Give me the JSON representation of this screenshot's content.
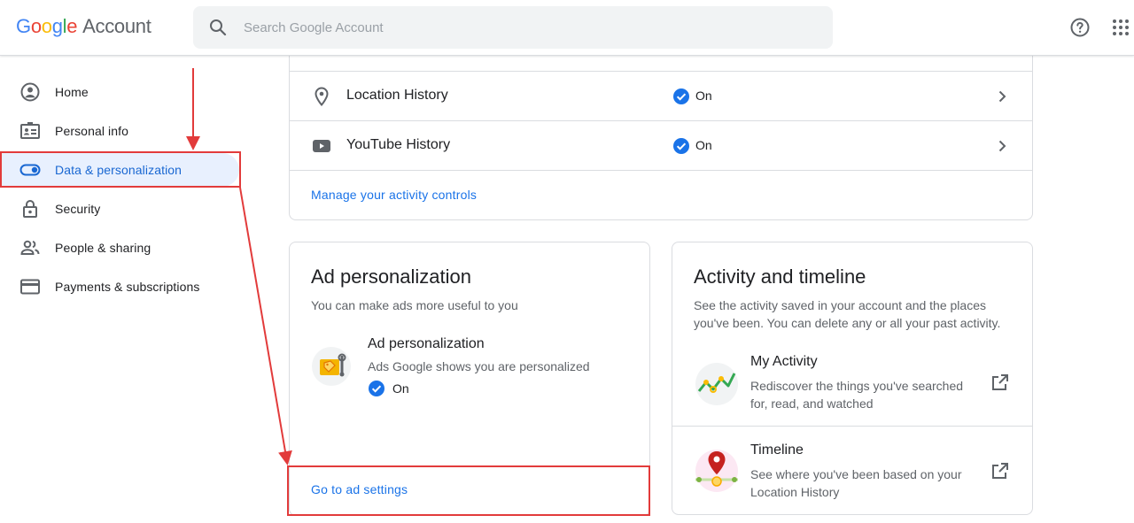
{
  "header": {
    "logo_google": [
      "G",
      "o",
      "o",
      "g",
      "l",
      "e"
    ],
    "logo_account": "Account",
    "search_placeholder": "Search Google Account",
    "icons": [
      "search-icon",
      "help-icon",
      "apps-icon"
    ]
  },
  "sidebar": {
    "items": [
      {
        "label": "Home",
        "icon": "home-icon",
        "active": false
      },
      {
        "label": "Personal info",
        "icon": "id-card-icon",
        "active": false
      },
      {
        "label": "Data & personalization",
        "icon": "toggle-icon",
        "active": true
      },
      {
        "label": "Security",
        "icon": "lock-icon",
        "active": false
      },
      {
        "label": "People & sharing",
        "icon": "people-icon",
        "active": false
      },
      {
        "label": "Payments & subscriptions",
        "icon": "credit-card-icon",
        "active": false
      }
    ]
  },
  "activity_controls": {
    "rows": [
      {
        "label": "Location History",
        "status": "On",
        "icon": "location-pin-icon"
      },
      {
        "label": "YouTube History",
        "status": "On",
        "icon": "youtube-icon"
      }
    ],
    "manage_link": "Manage your activity controls"
  },
  "ad_personalization": {
    "title": "Ad personalization",
    "subtitle": "You can make ads more useful to you",
    "item_title": "Ad personalization",
    "item_desc": "Ads Google shows you are personalized",
    "item_status": "On",
    "link": "Go to ad settings"
  },
  "activity_timeline": {
    "title": "Activity and timeline",
    "subtitle_line1": "See the activity saved in your account and the places",
    "subtitle_line2": "you've been. You can delete any or all your past activity.",
    "items": [
      {
        "title": "My Activity",
        "desc_line1": "Rediscover the things you've searched",
        "desc_line2": "for, read, and watched",
        "icon": "my-activity-icon"
      },
      {
        "title": "Timeline",
        "desc_line1": "See where you've been based on your",
        "desc_line2": "Location History",
        "icon": "timeline-icon"
      }
    ]
  },
  "colors": {
    "accent": "#1a73e8",
    "active_nav_bg": "#e8f0fe",
    "annotation": "#e23b3b"
  }
}
